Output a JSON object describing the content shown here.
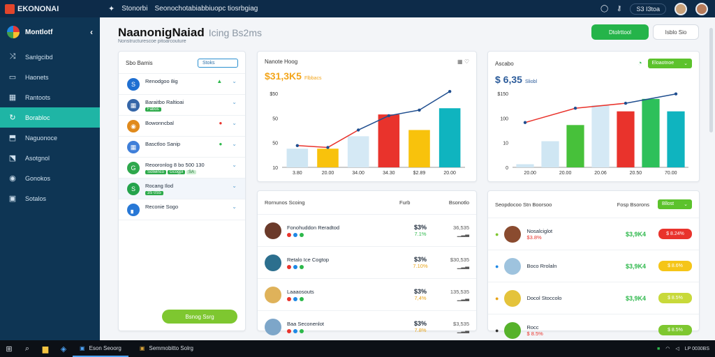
{
  "topbar": {
    "app": "EKONONAI",
    "search_label": "Stonorbi",
    "breadcrumb": "Seonochotabiabbiuopc tiosrbgiag",
    "pill": "S3 I3toa"
  },
  "sidebar": {
    "title": "Montlotf",
    "collapse": "‹",
    "items": [
      {
        "label": "Sanlgcibd",
        "icon": "⤨"
      },
      {
        "label": "Haonets",
        "icon": "▭"
      },
      {
        "label": "Rantoots",
        "icon": "▦"
      },
      {
        "label": "Borabloc",
        "icon": "↻",
        "active": true
      },
      {
        "label": "Naguonoce",
        "icon": "⬒"
      },
      {
        "label": "Asotgnol",
        "icon": "⬔"
      },
      {
        "label": "Gonokos",
        "icon": "◉"
      },
      {
        "label": "Sotalos",
        "icon": "▣"
      }
    ]
  },
  "header": {
    "title": "NaanonigNaiad",
    "title_sub": "Icing Bs2ms",
    "subtitle": "Nonstructurescoe pitoarcouture",
    "primary_btn": "Dtolrttool",
    "outline_btn": "Isblo  Sio"
  },
  "left": {
    "title": "Sbo Bamis",
    "dropdown": "Stoks",
    "items": [
      {
        "title": "Renodgoo 8ig",
        "tags": [],
        "badge": "▲",
        "color": "#1f6fd1",
        "icon": "S"
      },
      {
        "title": "Baraitbo Raltioai",
        "tags": [
          "Fabos"
        ],
        "badge": "",
        "color": "#3566a8",
        "icon": "▦"
      },
      {
        "title": "Bowonncbal",
        "tags": [],
        "badge": "●",
        "color": "#e08a1c",
        "icon": "◉"
      },
      {
        "title": "Basctloo Sanip",
        "tags": [],
        "badge": "●",
        "color": "#3f7fd9",
        "icon": "▦"
      },
      {
        "title": "Reooronlog 8 bo 500 130",
        "tags": [
          "Solwinco",
          "Gcogpl",
          "SA"
        ],
        "badge": "",
        "color": "#2ea84c",
        "icon": "G"
      },
      {
        "title": "Rocang Ilod",
        "tags": [
          "3S 0S5"
        ],
        "badge": "",
        "color": "#24a34b",
        "icon": "S"
      },
      {
        "title": "Reconie Sogo",
        "tags": [],
        "badge": "",
        "color": "#2878d6",
        "icon": "▖"
      }
    ],
    "button": "Bsnog Ssrg"
  },
  "chart1": {
    "title": "Nanote Hoog",
    "value": "$31,3K5",
    "value_sub": "Flbbacs"
  },
  "chart2": {
    "title": "Ascabo",
    "value": "$ 6,35",
    "value_sub": "Sliobl",
    "dropdown": "Eloaotnoe"
  },
  "table1": {
    "title": "Rornunos Scoing",
    "col1": "Furb",
    "col2": "Bsonotlo",
    "rows": [
      {
        "name": "Fonohuddon Reradtod",
        "value": "$3%",
        "pct": "7.1%",
        "num": "36,535",
        "pic": "#6b3a2a"
      },
      {
        "name": "Retalo Ice Cogtop",
        "value": "$3%",
        "pct": "7.10%",
        "num": "$30,535",
        "pic": "#2c6f8e"
      },
      {
        "name": "Laaaosouts",
        "value": "$3%",
        "pct": "7,4%",
        "num": "135,535",
        "pic": "#dfb25a"
      },
      {
        "name": "Baa Seconenlot",
        "value": "$3%",
        "pct": "7.8%",
        "num": "$3,535",
        "pic": "#7da6c9"
      }
    ]
  },
  "table2": {
    "title": "Seopdocoo Stn Boorsoo",
    "col1": "Fosp Bsorons",
    "button": "Bllost",
    "rows": [
      {
        "name": "Nosalciglot",
        "sub": "$3.8%",
        "value": "$3,9K4",
        "badge": "$ 8.24%",
        "badge_color": "#e9332c",
        "pic": "#8a4b2f"
      },
      {
        "name": "Boco Rrolaln",
        "sub": "",
        "value": "$3,9K4",
        "badge": "$ 8.6%",
        "badge_color": "#f5c518",
        "pic": "#9ec3de"
      },
      {
        "name": "Docol Stoccolo",
        "sub": "",
        "value": "$3,9K4",
        "badge": "$ 8.5%",
        "badge_color": "#c8d93a",
        "pic": "#e4c33b"
      },
      {
        "name": "Rocc",
        "sub": "$ 8.5%",
        "value": "",
        "badge": "$ 8.5%",
        "badge_color": "#7ec730",
        "pic": "#56b22b"
      }
    ]
  },
  "taskbar": {
    "app1": "Eson Seoorg",
    "app2": "Semmobitto Solrg",
    "clock": "LP 0030BS"
  },
  "chart_data": [
    {
      "type": "bar",
      "title": "",
      "categories": [
        "3.80",
        "20.00",
        "34.00",
        "34.30",
        "$2.89",
        "20.00"
      ],
      "ytick_labels": [
        "$50",
        "50",
        "50",
        "10"
      ],
      "series": [
        {
          "values": [
            30,
            30,
            50,
            85,
            60,
            95
          ]
        },
        {
          "values": [
            0,
            0,
            0,
            0,
            0,
            0
          ]
        }
      ],
      "line": [
        35,
        32,
        60,
        83,
        92,
        122
      ],
      "bar_colors": [
        "#cfe6f3",
        "#f8c20c",
        "#d5e9f5",
        "#e9332c",
        "#f8c20c",
        "#0fb4bf"
      ],
      "ylim": [
        0,
        130
      ]
    },
    {
      "type": "bar",
      "title": "",
      "categories": [
        "20.00",
        "20.00",
        "20.06",
        "20.50",
        "70.00"
      ],
      "ytick_labels": [
        "$150",
        "100",
        "10",
        "0"
      ],
      "values": [
        5,
        42,
        68,
        100,
        90,
        110,
        90
      ],
      "bar_colors": [
        "#cfe6f3",
        "#cfe6f3",
        "#47c13a",
        "#d5e9f5",
        "#e9332c",
        "#2dc05a",
        "#0fb4bf"
      ],
      "line": [
        72,
        95,
        103,
        118
      ],
      "ylim": [
        0,
        130
      ]
    }
  ]
}
